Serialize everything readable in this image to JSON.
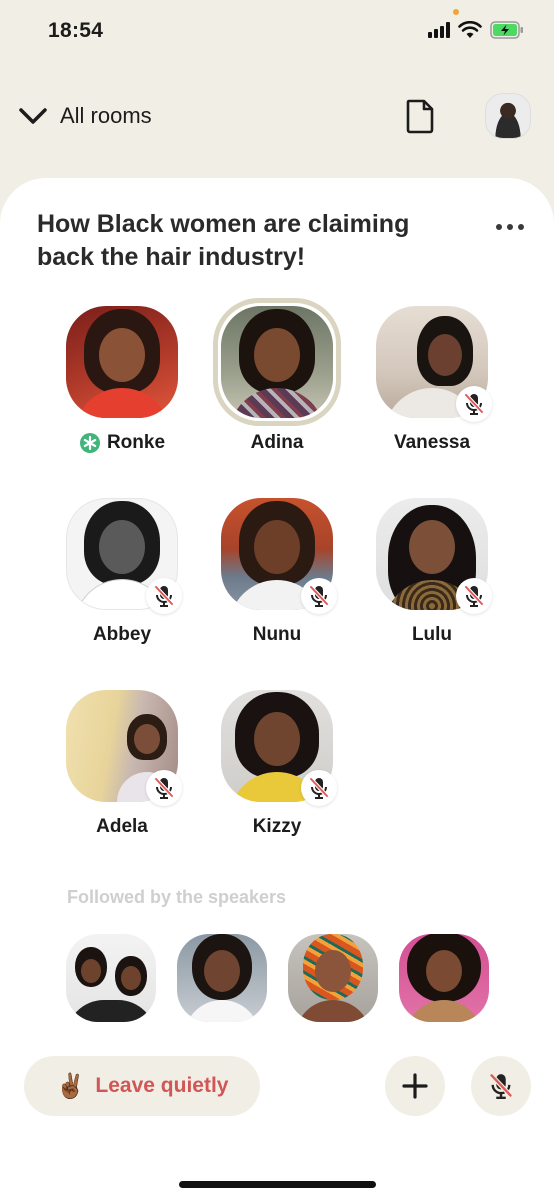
{
  "status_bar": {
    "time": "18:54"
  },
  "header": {
    "back_label": "All rooms"
  },
  "room": {
    "title": "How Black women are claiming back the hair industry!"
  },
  "speakers": [
    {
      "name": "Ronke",
      "moderator": true,
      "muted": false,
      "speaking": false
    },
    {
      "name": "Adina",
      "moderator": false,
      "muted": false,
      "speaking": true
    },
    {
      "name": "Vanessa",
      "moderator": false,
      "muted": true,
      "speaking": false
    },
    {
      "name": "Abbey",
      "moderator": false,
      "muted": true,
      "speaking": false
    },
    {
      "name": "Nunu",
      "moderator": false,
      "muted": true,
      "speaking": false
    },
    {
      "name": "Lulu",
      "moderator": false,
      "muted": true,
      "speaking": false
    },
    {
      "name": "Adela",
      "moderator": false,
      "muted": true,
      "speaking": false
    },
    {
      "name": "Kizzy",
      "moderator": false,
      "muted": true,
      "speaking": false
    }
  ],
  "followed_section": {
    "label": "Followed by the speakers"
  },
  "footer": {
    "leave_emoji": "✌🏾",
    "leave_label": "Leave quietly"
  },
  "colors": {
    "background": "#f1efe5",
    "sheet": "#ffffff",
    "leave_text": "#d15656",
    "moderator_green": "#3fb57a",
    "mute_red": "#e05a5a"
  },
  "icons": [
    "signal-icon",
    "wifi-icon",
    "battery-icon",
    "chevron-down-icon",
    "document-icon",
    "more-icon",
    "moderator-icon",
    "muted-mic-icon",
    "plus-icon"
  ]
}
